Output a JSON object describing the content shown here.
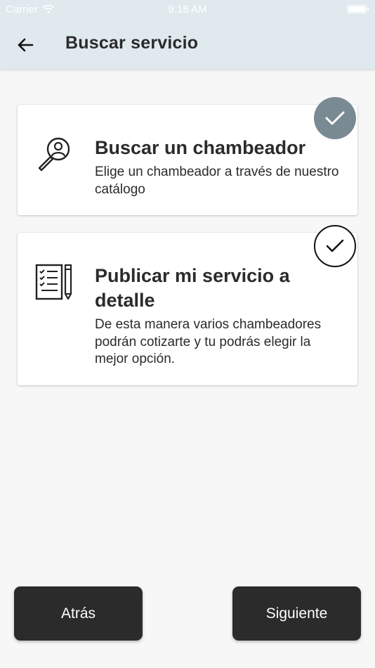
{
  "status_bar": {
    "carrier": "Carrier",
    "time": "9:18 AM",
    "icons": [
      "wifi-icon",
      "battery-icon"
    ]
  },
  "header": {
    "title": "Buscar servicio",
    "back_icon": "arrow-left-icon"
  },
  "options": [
    {
      "title": "Buscar un chambeador",
      "description": "Elige un chambeador a través de nuestro catálogo",
      "icon": "person-search-icon",
      "selected": true
    },
    {
      "title": "Publicar mi servicio a detalle",
      "description": "De esta manera varios chambeadores podrán cotizarte y tu podrás elegir la mejor opción.",
      "icon": "checklist-pencil-icon",
      "selected": false
    }
  ],
  "footer": {
    "back_label": "Atrás",
    "next_label": "Siguiente"
  },
  "colors": {
    "header_bg": "#dfe9ee",
    "button_bg": "#2b2b2b",
    "check_selected_bg": "#7a8a92",
    "page_bg": "#f7f7f7"
  }
}
